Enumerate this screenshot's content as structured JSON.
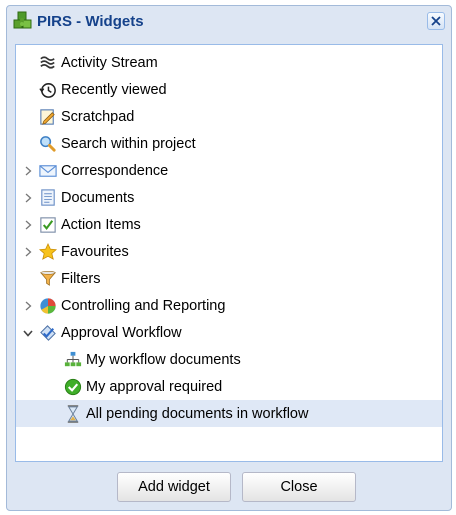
{
  "window": {
    "title": "PIRS - Widgets",
    "icon": "puzzle-pieces-icon",
    "accent": "#15428b"
  },
  "tree": [
    {
      "label": "Activity Stream",
      "icon": "stream-lines-icon",
      "level": 0,
      "expander": "none"
    },
    {
      "label": "Recently viewed",
      "icon": "history-clock-icon",
      "level": 0,
      "expander": "none"
    },
    {
      "label": "Scratchpad",
      "icon": "notepad-pencil-icon",
      "level": 0,
      "expander": "none"
    },
    {
      "label": "Search within project",
      "icon": "magnifier-icon",
      "level": 0,
      "expander": "none"
    },
    {
      "label": "Correspondence",
      "icon": "envelope-icon",
      "level": 0,
      "expander": "collapsed"
    },
    {
      "label": "Documents",
      "icon": "document-list-icon",
      "level": 0,
      "expander": "collapsed"
    },
    {
      "label": "Action Items",
      "icon": "checkbox-icon",
      "level": 0,
      "expander": "collapsed"
    },
    {
      "label": "Favourites",
      "icon": "star-icon",
      "level": 0,
      "expander": "collapsed"
    },
    {
      "label": "Filters",
      "icon": "funnel-icon",
      "level": 0,
      "expander": "none"
    },
    {
      "label": "Controlling and Reporting",
      "icon": "pie-chart-icon",
      "level": 0,
      "expander": "collapsed"
    },
    {
      "label": "Approval Workflow",
      "icon": "approval-stamp-icon",
      "level": 0,
      "expander": "expanded"
    },
    {
      "label": "My workflow documents",
      "icon": "org-chart-icon",
      "level": 1,
      "expander": "none"
    },
    {
      "label": "My approval required",
      "icon": "green-check-circle-icon",
      "level": 1,
      "expander": "none"
    },
    {
      "label": "All pending documents in workflow",
      "icon": "hourglass-icon",
      "level": 1,
      "expander": "none",
      "selected": true
    }
  ],
  "buttons": {
    "add": "Add widget",
    "close": "Close"
  }
}
